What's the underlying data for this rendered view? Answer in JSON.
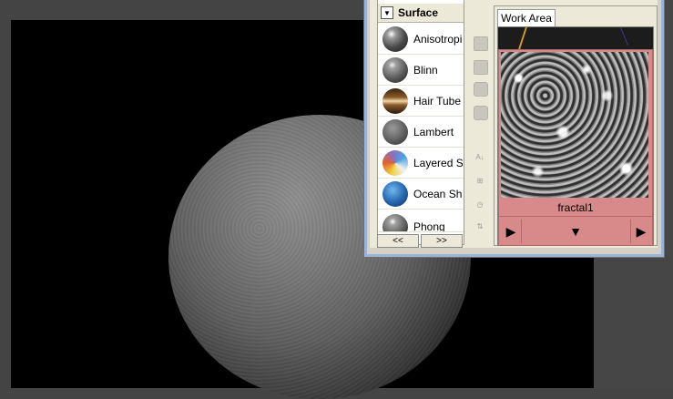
{
  "palette": {
    "header": "Surface",
    "items": [
      {
        "label": "Anisotropic",
        "color": "#6b6b6b"
      },
      {
        "label": "Blinn",
        "color": "#7a7a7a"
      },
      {
        "label": "Hair Tube",
        "color": "#8a5a2a"
      },
      {
        "label": "Lambert",
        "color": "#6a6a6a"
      },
      {
        "label": "Layered Sh",
        "color": "#8a70c0"
      },
      {
        "label": "Ocean Sha",
        "color": "#2a6ab0"
      },
      {
        "label": "Phong",
        "color": "#777777"
      }
    ],
    "prev_label": "<<",
    "next_label": ">>"
  },
  "work_area": {
    "tab_label": "Work Area",
    "node": {
      "name": "fractal1",
      "left_port": "▶",
      "mid_port": "▼",
      "right_port": "▶",
      "color": "#d88a8a"
    }
  },
  "colors": {
    "viewport_bg": "#000000",
    "window_bg": "#ece9d8",
    "window_border_accent": "#9bb3d6"
  }
}
